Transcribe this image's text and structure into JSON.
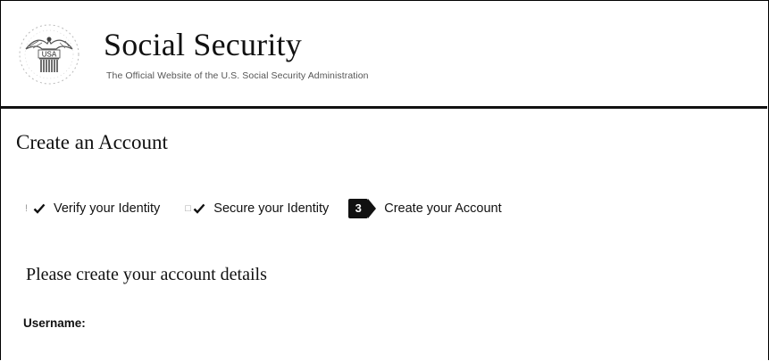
{
  "header": {
    "seal_text": "USA",
    "site_title": "Social Security",
    "site_subtitle": "The Official Website of the U.S. Social Security Administration"
  },
  "page": {
    "title": "Create an Account"
  },
  "steps": [
    {
      "label": "Verify your Identity",
      "status": "complete"
    },
    {
      "label": "Secure your Identity",
      "status": "complete"
    },
    {
      "number": "3",
      "label": "Create your Account",
      "status": "current"
    }
  ],
  "form": {
    "section_title": "Please create your account details",
    "username_label": "Username:"
  }
}
